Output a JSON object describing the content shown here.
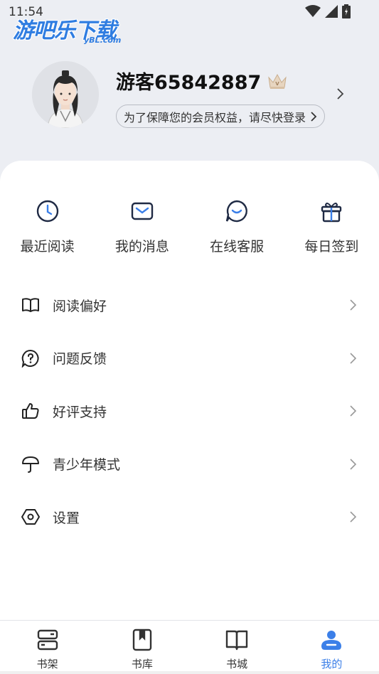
{
  "status": {
    "time": "11:54"
  },
  "watermark": {
    "main": "游吧乐下载",
    "sub": "yBL.com"
  },
  "profile": {
    "username": "游客65842887",
    "login_prompt": "为了保障您的会员权益，请尽快登录",
    "crown_icon": "crown-icon"
  },
  "shortcuts": [
    {
      "label": "最近阅读",
      "icon": "clock-icon"
    },
    {
      "label": "我的消息",
      "icon": "mail-icon"
    },
    {
      "label": "在线客服",
      "icon": "chat-smile-icon"
    },
    {
      "label": "每日签到",
      "icon": "gift-icon"
    }
  ],
  "menu": [
    {
      "label": "阅读偏好",
      "icon": "book-open-icon"
    },
    {
      "label": "问题反馈",
      "icon": "question-bubble-icon"
    },
    {
      "label": "好评支持",
      "icon": "thumbs-up-icon"
    },
    {
      "label": "青少年模式",
      "icon": "umbrella-icon"
    },
    {
      "label": "设置",
      "icon": "settings-hex-icon"
    }
  ],
  "nav": [
    {
      "label": "书架",
      "icon": "bookshelf-icon"
    },
    {
      "label": "书库",
      "icon": "library-icon"
    },
    {
      "label": "书城",
      "icon": "book-store-icon"
    },
    {
      "label": "我的",
      "icon": "profile-icon",
      "active": true
    }
  ],
  "colors": {
    "accent": "#3b7fe8",
    "background": "#eceef3"
  }
}
